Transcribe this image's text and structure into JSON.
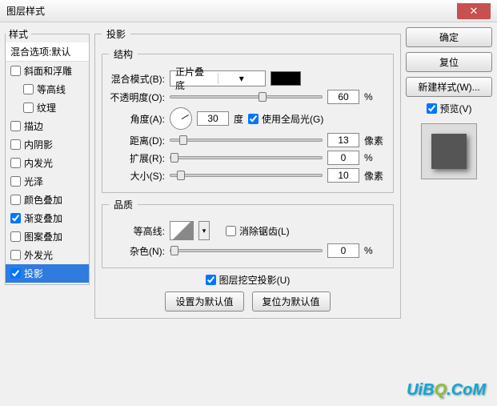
{
  "window": {
    "title": "图层样式"
  },
  "styles_panel": {
    "legend": "样式",
    "header": "混合选项:默认",
    "items": [
      {
        "label": "斜面和浮雕",
        "checked": false,
        "indent": false
      },
      {
        "label": "等高线",
        "checked": false,
        "indent": true
      },
      {
        "label": "纹理",
        "checked": false,
        "indent": true
      },
      {
        "label": "描边",
        "checked": false,
        "indent": false
      },
      {
        "label": "内阴影",
        "checked": false,
        "indent": false
      },
      {
        "label": "内发光",
        "checked": false,
        "indent": false
      },
      {
        "label": "光泽",
        "checked": false,
        "indent": false
      },
      {
        "label": "颜色叠加",
        "checked": false,
        "indent": false
      },
      {
        "label": "渐变叠加",
        "checked": true,
        "indent": false
      },
      {
        "label": "图案叠加",
        "checked": false,
        "indent": false
      },
      {
        "label": "外发光",
        "checked": false,
        "indent": false
      },
      {
        "label": "投影",
        "checked": true,
        "indent": false,
        "selected": true
      }
    ]
  },
  "center": {
    "legend": "投影",
    "structure": {
      "legend": "结构",
      "blend_mode_label": "混合模式(B):",
      "blend_mode_value": "正片叠底",
      "blend_color": "#000000",
      "opacity_label": "不透明度(O):",
      "opacity_value": "60",
      "opacity_unit": "%",
      "angle_label": "角度(A):",
      "angle_value": "30",
      "angle_unit": "度",
      "global_light_label": "使用全局光(G)",
      "global_light_checked": true,
      "distance_label": "距离(D):",
      "distance_value": "13",
      "distance_unit": "像素",
      "spread_label": "扩展(R):",
      "spread_value": "0",
      "spread_unit": "%",
      "size_label": "大小(S):",
      "size_value": "10",
      "size_unit": "像素"
    },
    "quality": {
      "legend": "品质",
      "contour_label": "等高线:",
      "antialias_label": "消除锯齿(L)",
      "antialias_checked": false,
      "noise_label": "杂色(N):",
      "noise_value": "0",
      "noise_unit": "%"
    },
    "knockout_label": "图层挖空投影(U)",
    "knockout_checked": true,
    "default_btn": "设置为默认值",
    "reset_btn": "复位为默认值"
  },
  "right": {
    "ok": "确定",
    "cancel": "复位",
    "new_style": "新建样式(W)...",
    "preview_label": "预览(V)",
    "preview_checked": true
  },
  "watermark": {
    "text_pre": "UiB",
    "text_o": "Q",
    "text_post": ".CoM"
  }
}
